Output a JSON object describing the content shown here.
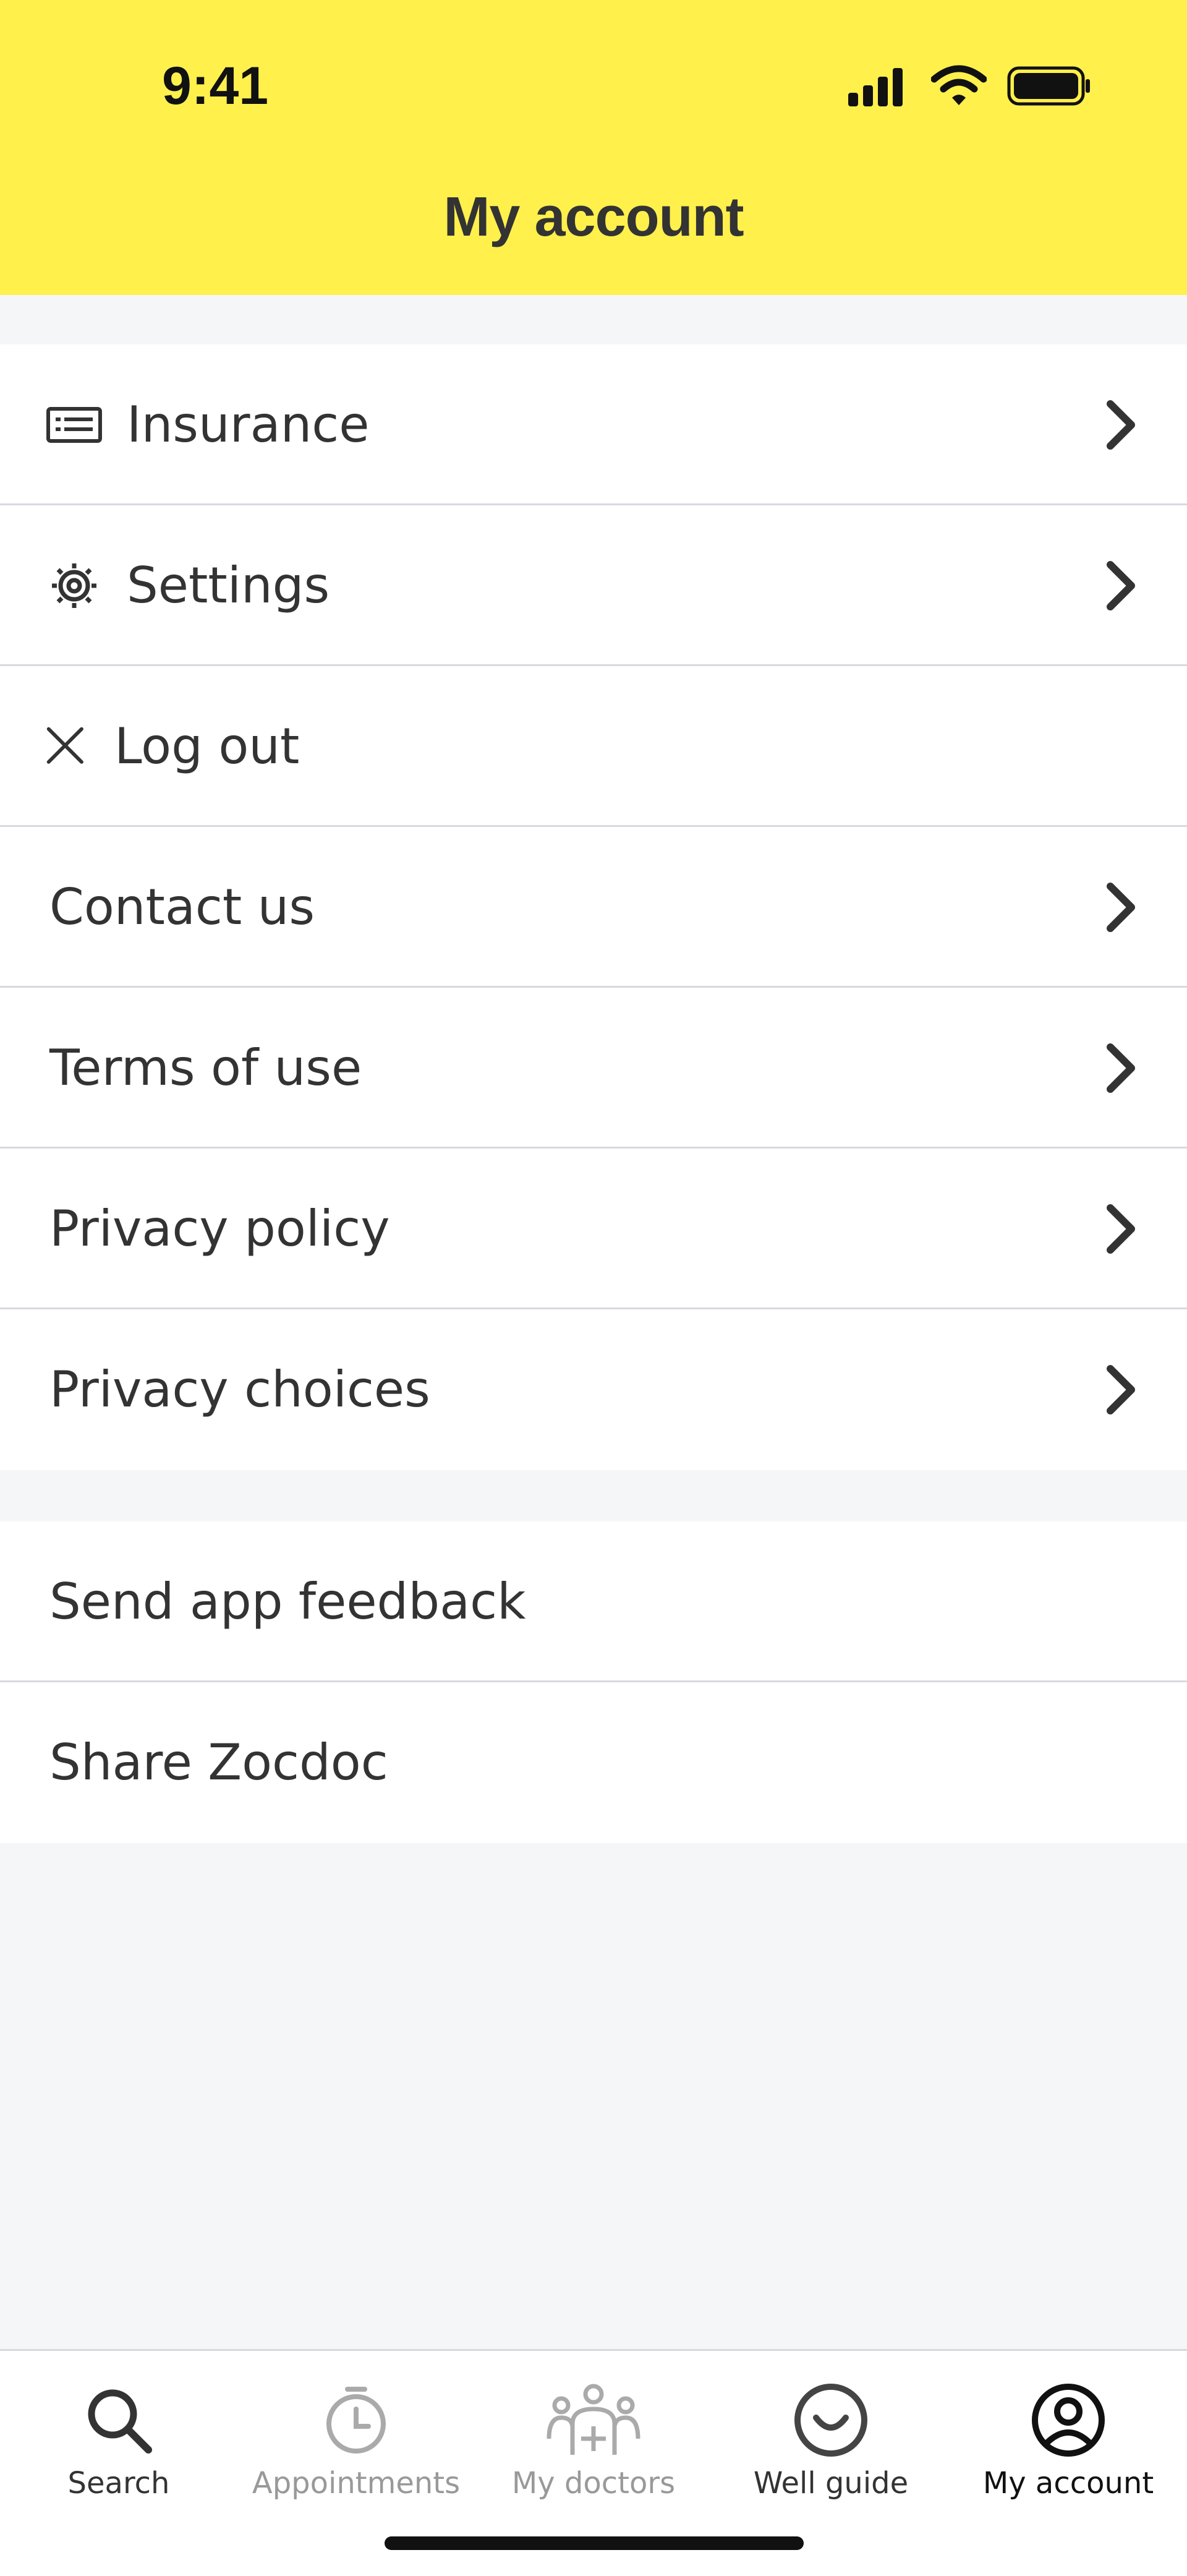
{
  "status_bar": {
    "time": "9:41"
  },
  "header": {
    "title": "My account"
  },
  "menu_group_1": [
    {
      "label": "Insurance",
      "icon": "id-card-icon",
      "chevron": true
    },
    {
      "label": "Settings",
      "icon": "gear-icon",
      "chevron": true
    },
    {
      "label": "Log out",
      "icon": "close-icon",
      "chevron": false
    },
    {
      "label": "Contact us",
      "chevron": true
    },
    {
      "label": "Terms of use",
      "chevron": true
    },
    {
      "label": "Privacy policy",
      "chevron": true
    },
    {
      "label": "Privacy choices",
      "chevron": true
    }
  ],
  "menu_group_2": [
    {
      "label": "Send app feedback"
    },
    {
      "label": "Share Zocdoc"
    }
  ],
  "tab_bar": {
    "tabs": [
      {
        "label": "Search",
        "icon": "search-icon",
        "state": "default"
      },
      {
        "label": "Appointments",
        "icon": "clock-icon",
        "state": "muted"
      },
      {
        "label": "My doctors",
        "icon": "doctors-icon",
        "state": "muted"
      },
      {
        "label": "Well guide",
        "icon": "smile-icon",
        "state": "default"
      },
      {
        "label": "My account",
        "icon": "account-icon",
        "state": "active"
      }
    ]
  },
  "colors": {
    "header_bg": "#fff04c",
    "page_bg": "#f5f6f8",
    "text": "#333333",
    "muted_text": "#999999",
    "active_text": "#111111"
  }
}
